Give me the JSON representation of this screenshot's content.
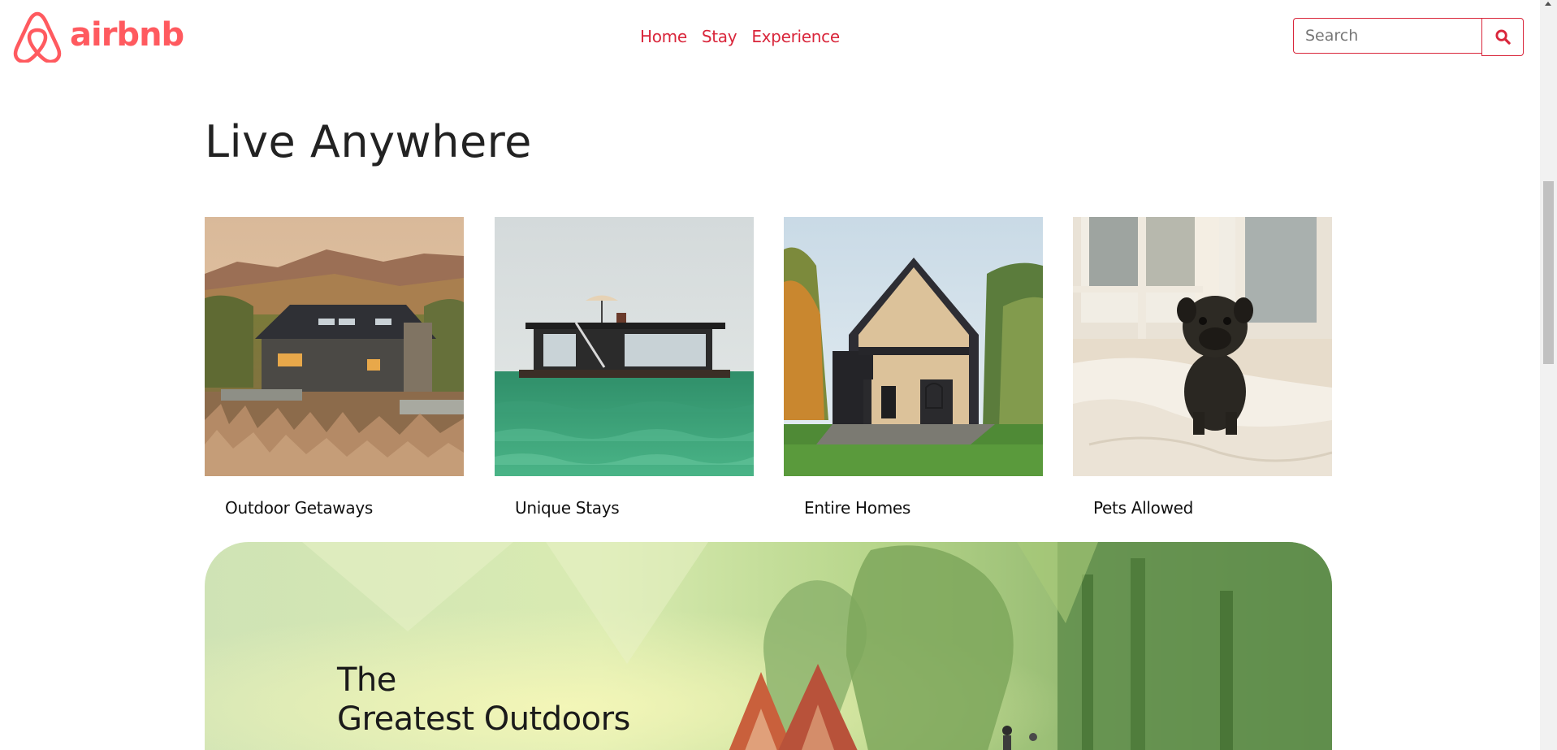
{
  "brand": {
    "name": "airbnb",
    "color": "#ff5a5f"
  },
  "nav": {
    "items": [
      {
        "label": "Home"
      },
      {
        "label": "Stay"
      },
      {
        "label": "Experience"
      }
    ],
    "color": "#d9263b"
  },
  "search": {
    "placeholder": "Search",
    "value": "",
    "button_icon": "search-icon"
  },
  "main": {
    "title": "Live Anywhere",
    "cards": [
      {
        "label": "Outdoor Getaways",
        "image": "cabin-on-hillside"
      },
      {
        "label": "Unique Stays",
        "image": "houseboat-on-water"
      },
      {
        "label": "Entire Homes",
        "image": "a-frame-house"
      },
      {
        "label": "Pets Allowed",
        "image": "pug-on-bed"
      }
    ]
  },
  "banner": {
    "title_line1": "The",
    "title_line2": "Greatest Outdoors",
    "image": "forest-cabins-illustration"
  }
}
